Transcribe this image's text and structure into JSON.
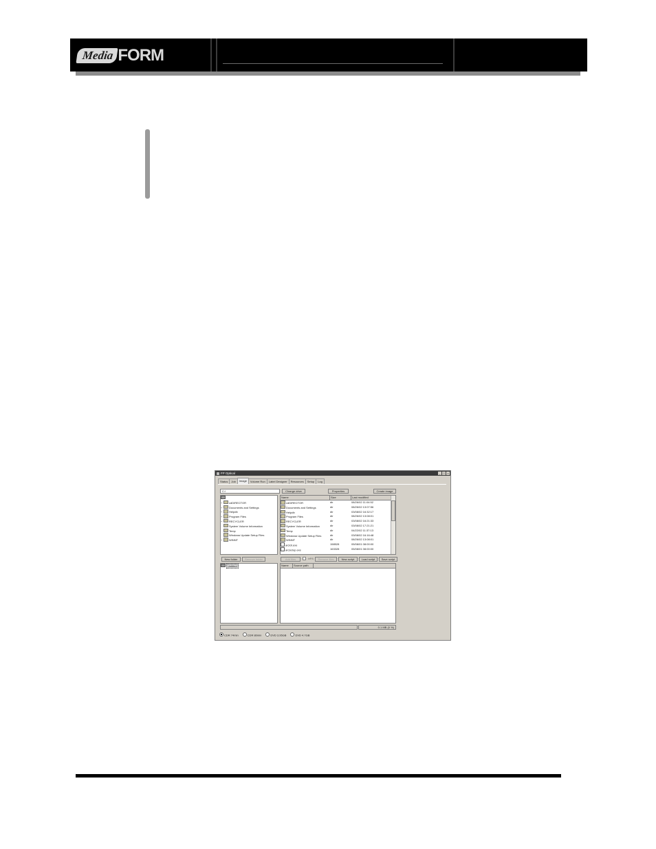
{
  "header": {
    "logo_media": "Media",
    "logo_form": "FORM"
  },
  "app": {
    "title": "FP Optical",
    "window_buttons": [
      "_",
      "□",
      "×"
    ],
    "tabs": [
      "Status",
      "Job",
      "Image",
      "Volume Run",
      "Label Designer",
      "Resources",
      "Setup",
      "Log"
    ],
    "active_tab": "Image",
    "path_value": "C:\\",
    "buttons": {
      "change_drive": "Change drive",
      "properties": "Properties",
      "create_image": "Create image",
      "new_folder": "New folder",
      "remove_folder": "Remove folder",
      "add_files": "Add files",
      "remove_files": "Remove files",
      "new_script": "New script",
      "load_script": "Load script",
      "save_script": "Save script"
    },
    "checkbox_label": "XFS",
    "tree": [
      {
        "label": "cdDIRECTOR",
        "exp": "+"
      },
      {
        "label": "Documents and Settings",
        "exp": "+"
      },
      {
        "label": "Helpdb",
        "exp": "+"
      },
      {
        "label": "Program Files",
        "exp": "+"
      },
      {
        "label": "RECYCLER",
        "exp": "+"
      },
      {
        "label": "System Volume Information",
        "exp": ""
      },
      {
        "label": "Temp",
        "exp": ""
      },
      {
        "label": "Windows Update Setup Files",
        "exp": ""
      },
      {
        "label": "WINNT",
        "exp": "+"
      }
    ],
    "list_headers": [
      "Name",
      "Size",
      "Last modified"
    ],
    "files": [
      {
        "name": "cdDIRECTOR",
        "size": "dir",
        "date": "08/26/02 11:04:52",
        "icon": "folder"
      },
      {
        "name": "Documents and Settings",
        "size": "dir",
        "date": "08/26/02 13:07:56",
        "icon": "folder"
      },
      {
        "name": "Helpdb",
        "size": "dir",
        "date": "03/08/02 16:32:17",
        "icon": "folder"
      },
      {
        "name": "Program Files",
        "size": "dir",
        "date": "08/26/02 13:08:01",
        "icon": "folder"
      },
      {
        "name": "RECYCLER",
        "size": "dir",
        "date": "03/08/02 16:21:33",
        "icon": "folder"
      },
      {
        "name": "System Volume Information",
        "size": "dir",
        "date": "03/08/02 17:21:21",
        "icon": "folder"
      },
      {
        "name": "Temp",
        "size": "dir",
        "date": "04/22/02 11:37:13",
        "icon": "folder"
      },
      {
        "name": "Windows Update Setup Files",
        "size": "dir",
        "date": "03/08/02 16:16:48",
        "icon": "folder"
      },
      {
        "name": "WINNT",
        "size": "dir",
        "date": "08/26/02 13:08:01",
        "icon": "folder"
      },
      {
        "name": "arcldr.exe",
        "size": "158528",
        "date": "05/08/01 08:00:00",
        "icon": "file"
      },
      {
        "name": "arcsetup.exe",
        "size": "163328",
        "date": "05/08/01 08:00:00",
        "icon": "file"
      }
    ],
    "compilation_root": "Untitled",
    "comp_headers": [
      "Name",
      "Source path"
    ],
    "size_readout": "0.1 MB (0 %)",
    "media_options": [
      {
        "label": "CDR 74min",
        "selected": true
      },
      {
        "label": "CDR 80min",
        "selected": false
      },
      {
        "label": "DVD 3.95GB",
        "selected": false
      },
      {
        "label": "DVD 4.7GB",
        "selected": false
      }
    ]
  }
}
